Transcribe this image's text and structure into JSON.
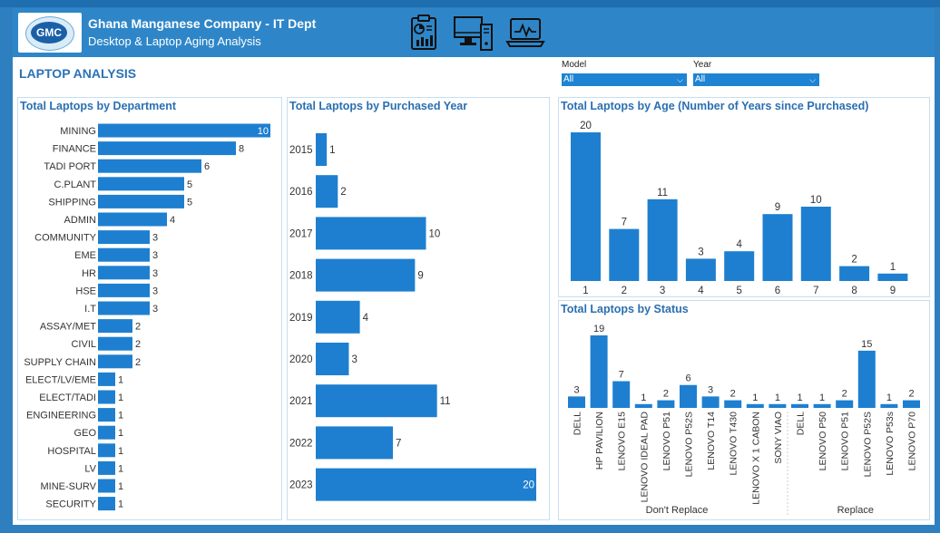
{
  "header": {
    "company": "Ghana Manganese Company - IT Dept",
    "subtitle": "Desktop & Laptop Aging Analysis",
    "logo_text": "GMC",
    "icons": [
      "clipboard-report-icon",
      "desktop-computer-icon",
      "laptop-analytics-icon"
    ]
  },
  "page_title": "LAPTOP ANALYSIS",
  "filters": {
    "model": {
      "label": "Model",
      "value": "All"
    },
    "year": {
      "label": "Year",
      "value": "All"
    }
  },
  "colors": {
    "bar": "#1e7fd0",
    "header": "#2e86c8",
    "title": "#2a72b5"
  },
  "chart_data": [
    {
      "id": "by-department",
      "type": "bar",
      "orientation": "horizontal",
      "title": "Total Laptops by Department",
      "categories": [
        "MINING",
        "FINANCE",
        "TADI PORT",
        "C.PLANT",
        "SHIPPING",
        "ADMIN",
        "COMMUNITY",
        "EME",
        "HR",
        "HSE",
        "I.T",
        "ASSAY/MET",
        "CIVIL",
        "SUPPLY CHAIN",
        "ELECT/LV/EME",
        "ELECT/TADI",
        "ENGINEERING",
        "GEO",
        "HOSPITAL",
        "LV",
        "MINE-SURV",
        "SECURITY"
      ],
      "values": [
        10,
        8,
        6,
        5,
        5,
        4,
        3,
        3,
        3,
        3,
        3,
        2,
        2,
        2,
        1,
        1,
        1,
        1,
        1,
        1,
        1,
        1
      ],
      "xlim": [
        0,
        10
      ]
    },
    {
      "id": "by-year",
      "type": "bar",
      "orientation": "horizontal",
      "title": "Total Laptops by Purchased Year",
      "categories": [
        "2015",
        "2016",
        "2017",
        "2018",
        "2019",
        "2020",
        "2021",
        "2022",
        "2023"
      ],
      "values": [
        1,
        2,
        10,
        9,
        4,
        3,
        11,
        7,
        20
      ],
      "xlim": [
        0,
        20
      ]
    },
    {
      "id": "by-age",
      "type": "bar",
      "orientation": "vertical",
      "title": "Total Laptops by Age (Number of Years since Purchased)",
      "categories": [
        "1",
        "2",
        "3",
        "4",
        "5",
        "6",
        "7",
        "8",
        "9"
      ],
      "values": [
        20,
        7,
        11,
        3,
        4,
        9,
        10,
        2,
        1
      ],
      "ylim": [
        0,
        20
      ]
    },
    {
      "id": "by-status",
      "type": "bar",
      "orientation": "vertical",
      "title": "Total Laptops by Status",
      "groups": [
        {
          "name": "Don't Replace",
          "categories": [
            "DELL",
            "HP PAVILION",
            "LENOVO E15",
            "LENOVO IDEAL PAD",
            "LENOVO P51",
            "LENOVO P52S",
            "LENOVO T14",
            "LENOVO T430",
            "LENOVO X 1 CABON",
            "SONY VIAO"
          ],
          "values": [
            3,
            19,
            7,
            1,
            2,
            6,
            3,
            2,
            1,
            1
          ]
        },
        {
          "name": "Replace",
          "categories": [
            "DELL",
            "LENOVO P50",
            "LENOVO P51",
            "LENOVO P52S",
            "LENOVO P53s",
            "LENOVO P70"
          ],
          "values": [
            1,
            1,
            2,
            15,
            1,
            2
          ]
        }
      ],
      "ylim": [
        0,
        19
      ]
    }
  ]
}
